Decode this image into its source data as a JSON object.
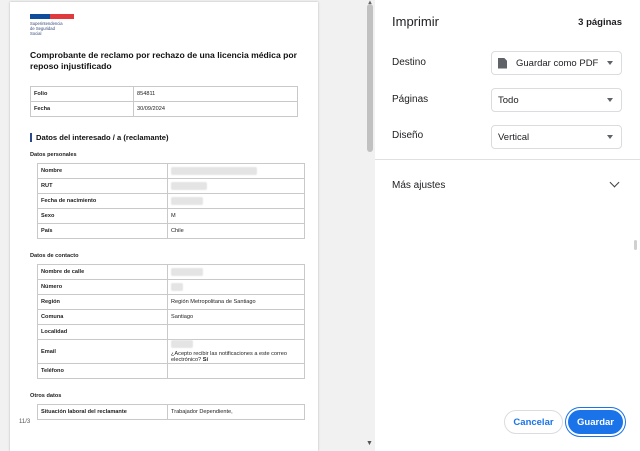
{
  "document": {
    "logo_text": [
      "Superintendencia",
      "de Seguridad",
      "Social"
    ],
    "title": "Comprobante de reclamo por rechazo de una licencia médica por reposo injustificado",
    "summary_rows": [
      {
        "label": "Folio",
        "value": "854811"
      },
      {
        "label": "Fecha",
        "value": "30/09/2024"
      }
    ],
    "section_title": "Datos del interesado / a (reclamante)",
    "personal_heading": "Datos personales",
    "personal_rows": [
      {
        "label": "Nombre",
        "value": ""
      },
      {
        "label": "RUT",
        "value": ""
      },
      {
        "label": "Fecha de nacimiento",
        "value": ""
      },
      {
        "label": "Sexo",
        "value": "M"
      },
      {
        "label": "País",
        "value": "Chile"
      }
    ],
    "contact_heading": "Datos de contacto",
    "contact_rows": [
      {
        "label": "Nombre de calle",
        "value": ""
      },
      {
        "label": "Número",
        "value": ""
      },
      {
        "label": "Región",
        "value": "Región Metropolitana de Santiago"
      },
      {
        "label": "Comuna",
        "value": "Santiago"
      },
      {
        "label": "Localidad",
        "value": ""
      }
    ],
    "email_label": "Email",
    "email_question": "¿Acepto recibir las notificaciones a este correo electrónico?",
    "email_answer": "Sí",
    "phone_label": "Teléfono",
    "other_heading": "Otros datos",
    "other_rows": [
      {
        "label": "Situación laboral del reclamante",
        "value": "Trabajador Dependiente,"
      }
    ],
    "page_number": "11/3"
  },
  "panel": {
    "title": "Imprimir",
    "page_count": "3 páginas",
    "destination_label": "Destino",
    "destination_value": "Guardar como PDF",
    "destination_icon": "file-icon",
    "pages_label": "Páginas",
    "pages_value": "Todo",
    "layout_label": "Diseño",
    "layout_value": "Vertical",
    "more_settings": "Más ajustes",
    "cancel": "Cancelar",
    "save": "Guardar",
    "accent": "#1a73e8"
  }
}
